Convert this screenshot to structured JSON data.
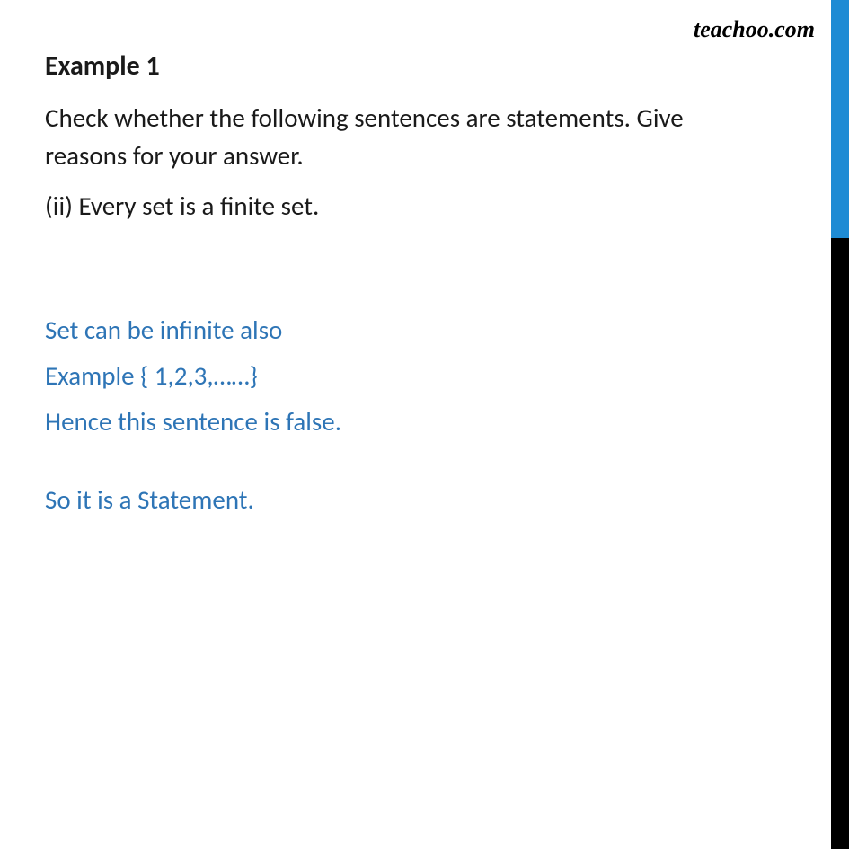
{
  "watermark": "teachoo.com",
  "heading": "Example 1",
  "question": {
    "main": "Check whether the following sentences are statements. Give reasons for your answer.",
    "sub": "(ii) Every set is a finite set."
  },
  "answer": {
    "line1": "Set can be infinite also",
    "line2": "Example { 1,2,3,……}",
    "line3": "Hence this sentence is false.",
    "conclusion": "So it is a Statement."
  }
}
